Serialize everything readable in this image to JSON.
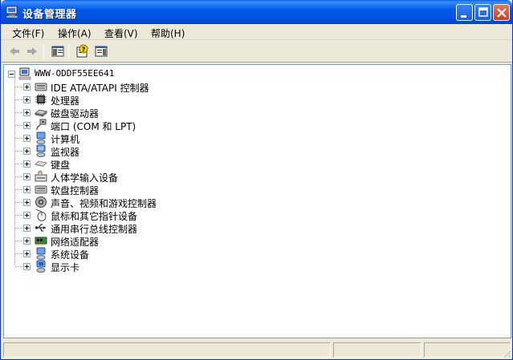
{
  "window": {
    "title": "设备管理器",
    "icon": "device-manager-icon"
  },
  "menu": [
    {
      "label": "文件(F)"
    },
    {
      "label": "操作(A)"
    },
    {
      "label": "查看(V)"
    },
    {
      "label": "帮助(H)"
    }
  ],
  "toolbar": {
    "back": "back-arrow-icon",
    "forward": "forward-arrow-icon",
    "show_hide_tree": "console-tree-icon",
    "help": "help-icon",
    "properties": "properties-icon"
  },
  "tree": {
    "root": "WWW-ODDF55EE641",
    "items": [
      {
        "label": "IDE ATA/ATAPI 控制器",
        "icon": "ide-controller-icon"
      },
      {
        "label": "处理器",
        "icon": "processor-icon"
      },
      {
        "label": "磁盘驱动器",
        "icon": "disk-drive-icon"
      },
      {
        "label": "端口 (COM 和 LPT)",
        "icon": "port-icon"
      },
      {
        "label": "计算机",
        "icon": "computer-icon"
      },
      {
        "label": "监视器",
        "icon": "monitor-icon"
      },
      {
        "label": "键盘",
        "icon": "keyboard-icon"
      },
      {
        "label": "人体学输入设备",
        "icon": "hid-icon"
      },
      {
        "label": "软盘控制器",
        "icon": "floppy-controller-icon"
      },
      {
        "label": "声音、视频和游戏控制器",
        "icon": "sound-icon"
      },
      {
        "label": "鼠标和其它指针设备",
        "icon": "mouse-icon"
      },
      {
        "label": "通用串行总线控制器",
        "icon": "usb-icon"
      },
      {
        "label": "网络适配器",
        "icon": "network-adapter-icon"
      },
      {
        "label": "系统设备",
        "icon": "system-device-icon"
      },
      {
        "label": "显示卡",
        "icon": "display-adapter-icon"
      }
    ]
  },
  "colors": {
    "titlebar": "#0054e3",
    "chrome": "#ece9d8",
    "close": "#c9401f"
  }
}
